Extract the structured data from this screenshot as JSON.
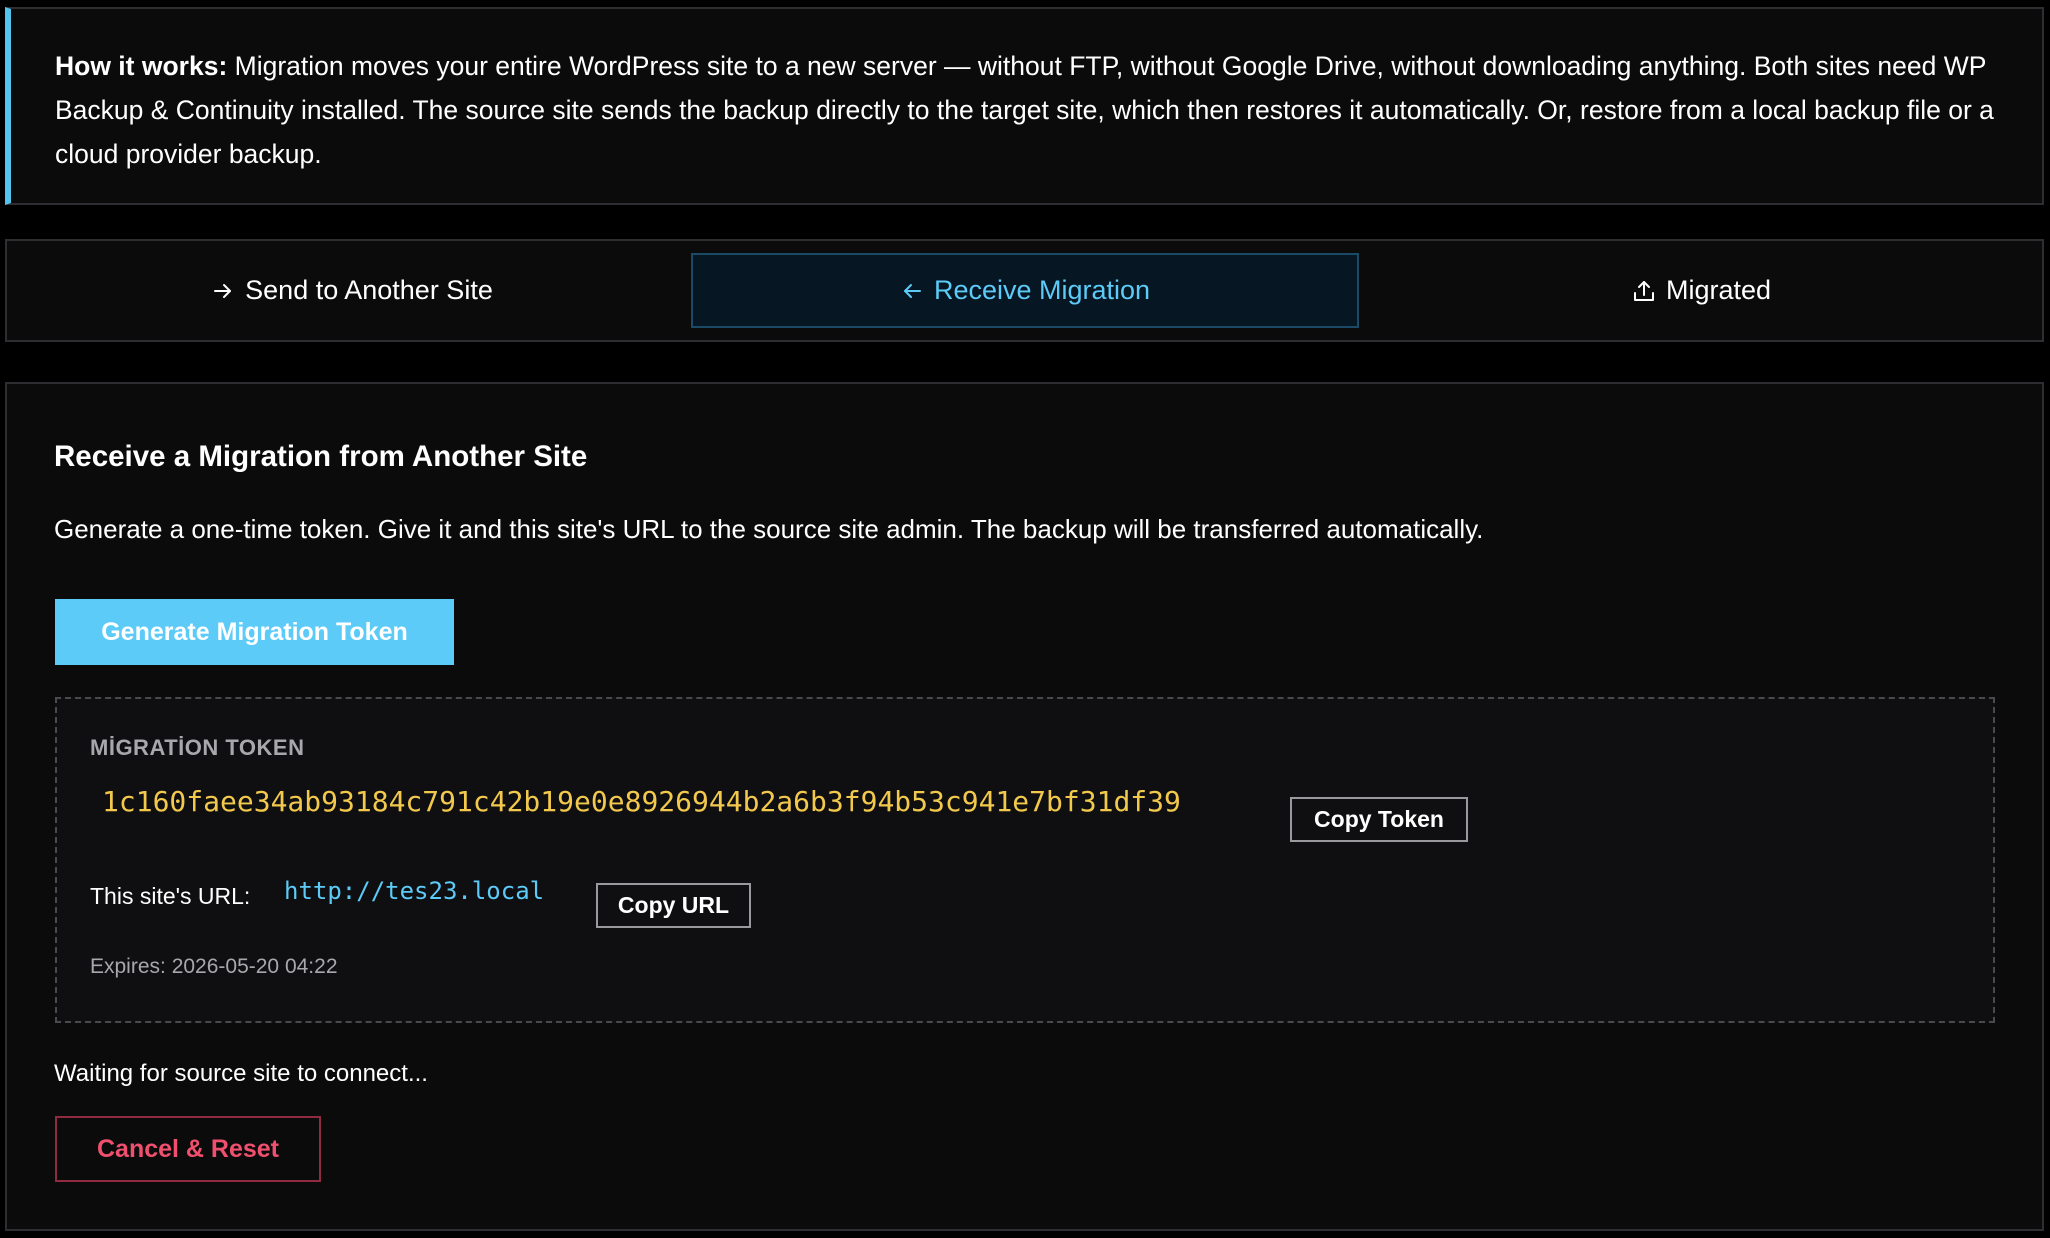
{
  "info": {
    "lead": "How it works:",
    "text": " Migration moves your entire WordPress site to a new server — without FTP, without Google Drive, without downloading anything. Both sites need WP Backup & Continuity installed. The source site sends the backup directly to the target site, which then restores it automatically. Or, restore from a local backup file or a cloud provider backup."
  },
  "tabs": [
    {
      "label": "Send to Another Site",
      "icon": "arrow-right-icon",
      "active": false
    },
    {
      "label": "Receive Migration",
      "icon": "arrow-left-icon",
      "active": true
    },
    {
      "label": "Migrated",
      "icon": "upload-icon",
      "active": false
    }
  ],
  "panel": {
    "title": "Receive a Migration from Another Site",
    "description": "Generate a one-time token. Give it and this site's URL to the source site admin. The backup will be transferred automatically.",
    "generate_button": "Generate Migration Token",
    "token_label": "MİGRATİON TOKEN",
    "token_value": "1c160faee34ab93184c791c42b19e0e8926944b2a6b3f94b53c941e7bf31df39",
    "copy_token_button": "Copy Token",
    "url_label": "This site's URL:",
    "url_value": "http://tes23.local",
    "copy_url_button": "Copy URL",
    "expires": "Expires: 2026-05-20 04:22",
    "waiting": "Waiting for source site to connect...",
    "cancel_button": "Cancel & Reset"
  },
  "colors": {
    "accent": "#5ccbf7",
    "token": "#f2c94c",
    "danger": "#f0506e",
    "background": "#0b0b0c"
  }
}
